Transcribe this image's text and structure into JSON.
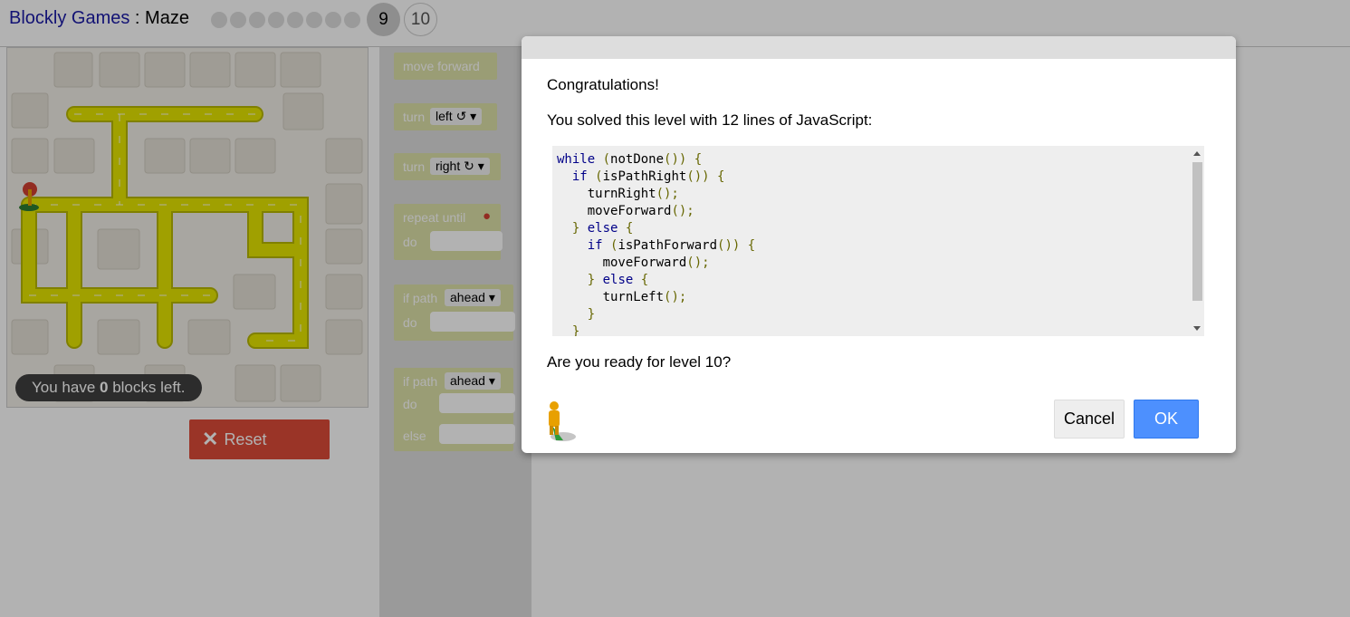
{
  "header": {
    "brand": "Blockly Games",
    "separator": " : ",
    "game": "Maze",
    "levels": {
      "current": "9",
      "next": "10",
      "completed_count": 8
    }
  },
  "maze": {
    "capacity": {
      "prefix": "You have ",
      "count": "0",
      "suffix": " blocks left."
    },
    "reset_label": "Reset",
    "path_color": "#e6e600",
    "background_color": "#f1eee7"
  },
  "toolbox": {
    "move_forward": "move forward",
    "turn_left": {
      "label": "turn",
      "dropdown": "left ↺"
    },
    "turn_right": {
      "label": "turn",
      "dropdown": "right ↻"
    },
    "repeat_until": {
      "label": "repeat until",
      "do": "do",
      "icon": "map-marker-icon"
    },
    "if_path": {
      "label": "if path",
      "dropdown": "ahead",
      "do": "do"
    },
    "if_else_path": {
      "label": "if path",
      "dropdown": "ahead",
      "do": "do",
      "else": "else"
    },
    "block_color": "#dde1a8"
  },
  "dialog": {
    "title": "Congratulations!",
    "message": "You solved this level with 12 lines of JavaScript:",
    "code_lines": [
      "while (notDone()) {",
      "  if (isPathRight()) {",
      "    turnRight();",
      "    moveForward();",
      "  } else {",
      "    if (isPathForward()) {",
      "      moveForward();",
      "    } else {",
      "      turnLeft();",
      "    }",
      "  }"
    ],
    "question": "Are you ready for level 10?",
    "cancel_label": "Cancel",
    "ok_label": "OK",
    "ok_color": "#4d90fe"
  }
}
